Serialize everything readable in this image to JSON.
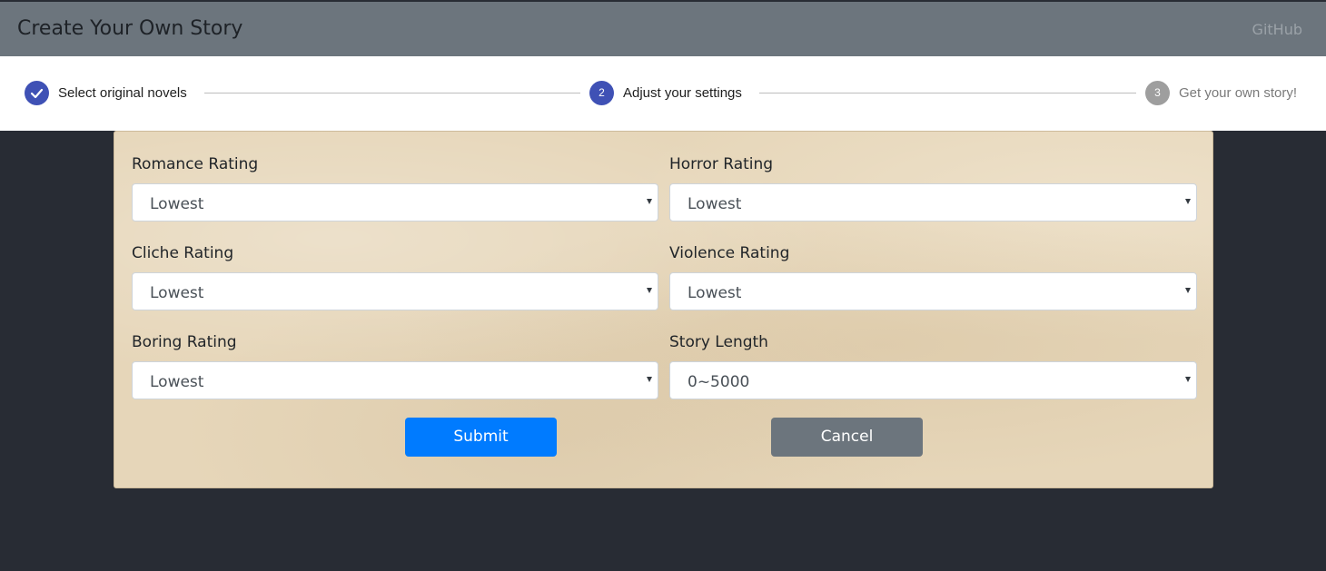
{
  "navbar": {
    "brand": "Create Your Own Story",
    "link": "GitHub"
  },
  "stepper": {
    "steps": [
      {
        "label": "Select original novels",
        "icon": "check-icon",
        "state": "completed"
      },
      {
        "label": "Adjust your settings",
        "number": "2",
        "state": "active"
      },
      {
        "label": "Get your own story!",
        "number": "3",
        "state": "inactive"
      }
    ]
  },
  "form": {
    "fields": [
      {
        "label": "Romance Rating",
        "value": "Lowest"
      },
      {
        "label": "Horror Rating",
        "value": "Lowest"
      },
      {
        "label": "Cliche Rating",
        "value": "Lowest"
      },
      {
        "label": "Violence Rating",
        "value": "Lowest"
      },
      {
        "label": "Boring Rating",
        "value": "Lowest"
      },
      {
        "label": "Story Length",
        "value": "0~5000"
      }
    ],
    "submit_label": "Submit",
    "cancel_label": "Cancel"
  },
  "colors": {
    "navbar": "#6c757d",
    "step_active": "#3f51b5",
    "step_inactive": "#9e9e9e",
    "primary": "#007bff",
    "secondary": "#6c757d",
    "background": "#282c34",
    "panel": "#e6d6b9"
  }
}
